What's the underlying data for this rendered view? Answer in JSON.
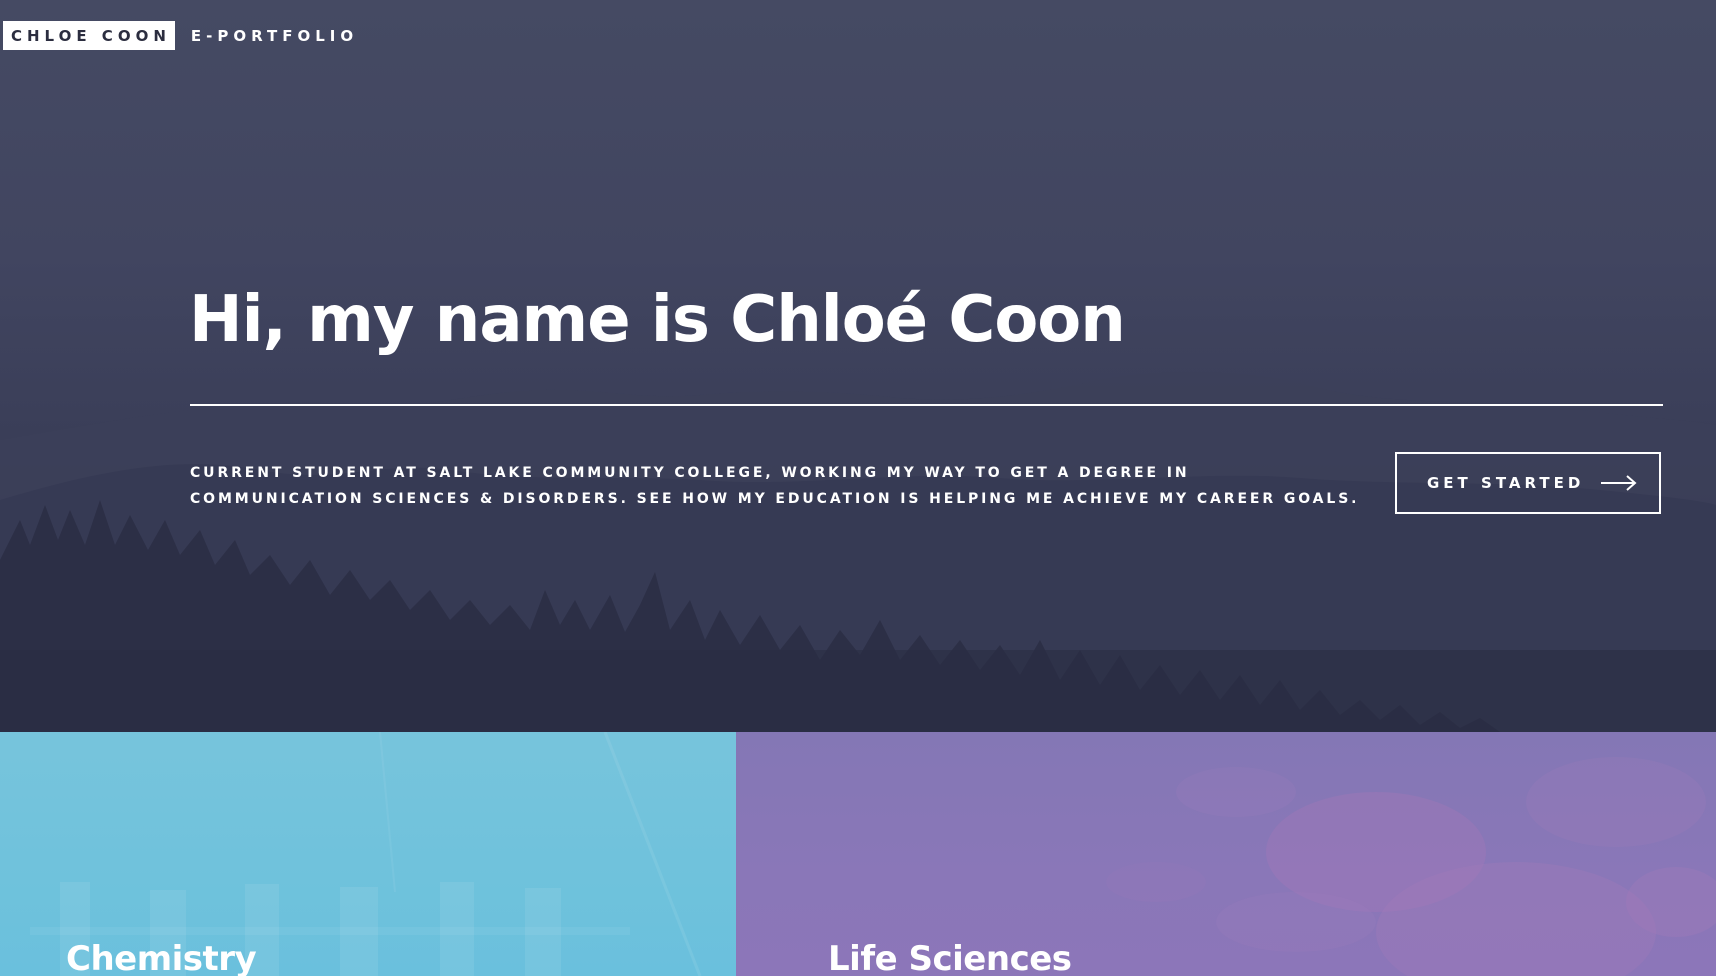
{
  "header": {
    "brand_name": "CHLOE COON",
    "brand_subtitle": "E-PORTFOLIO"
  },
  "hero": {
    "title": "Hi, my name is Chloé Coon",
    "description": "CURRENT STUDENT AT SALT LAKE COMMUNITY COLLEGE, WORKING MY WAY TO GET A DEGREE IN COMMUNICATION SCIENCES & DISORDERS. SEE HOW MY EDUCATION IS HELPING ME ACHIEVE MY CAREER GOALS.",
    "cta_label": "GET STARTED",
    "cta_icon": "arrow-right-icon"
  },
  "tiles": [
    {
      "title": "Chemistry",
      "color": "#72c3dc"
    },
    {
      "title": "Life Sciences",
      "color": "#8877b7"
    }
  ],
  "colors": {
    "hero_overlay": "#40445e",
    "text": "#ffffff"
  }
}
